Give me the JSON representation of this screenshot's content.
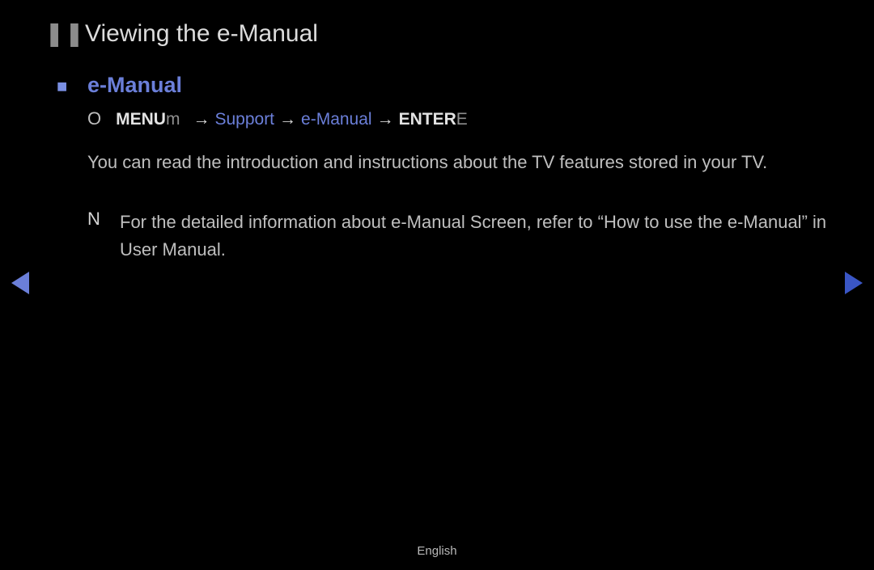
{
  "title": {
    "bullet": "❚❚",
    "text": "Viewing the e-Manual"
  },
  "subheading": {
    "bullet": "■",
    "text": "e-Manual"
  },
  "path": {
    "o": "O",
    "menu": "MENU",
    "menu_suffix": "m",
    "arrow": "→",
    "support": "Support",
    "emanual": "e-Manual",
    "enter": "ENTER",
    "enter_suffix": "E"
  },
  "body": "You can read the introduction and instructions about the TV features stored in your TV.",
  "note": {
    "n": "N",
    "text": "For the detailed information about e-Manual Screen, refer to “How to use the e-Manual” in User Manual."
  },
  "footer": "English"
}
